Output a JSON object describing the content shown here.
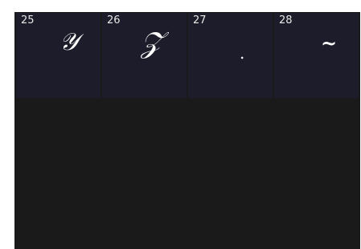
{
  "glyph_grid": {
    "cells": [
      {
        "number": "25",
        "glyph": "𝒴"
      },
      {
        "number": "26",
        "glyph": "𝒵"
      },
      {
        "number": "27",
        "glyph": "."
      },
      {
        "number": "28",
        "glyph": "~"
      }
    ]
  },
  "colors": {
    "background": "#1a1a1a",
    "cell_background": "#1c1c2a",
    "text": "#e8e8e8"
  }
}
